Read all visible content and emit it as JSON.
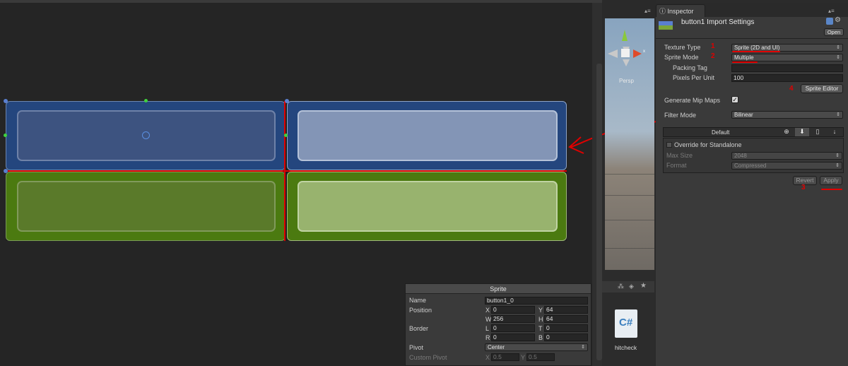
{
  "sprite_panel": {
    "title": "Sprite",
    "name_label": "Name",
    "name_value": "button1_0",
    "position_label": "Position",
    "x_label": "X",
    "x_value": "0",
    "y_label": "Y",
    "y_value": "64",
    "w_label": "W",
    "w_value": "256",
    "h_label": "H",
    "h_value": "64",
    "border_label": "Border",
    "l_label": "L",
    "l_value": "0",
    "t_label": "T",
    "t_value": "0",
    "r_label": "R",
    "r_value": "0",
    "b_label": "B",
    "b_value": "0",
    "pivot_label": "Pivot",
    "pivot_value": "Center",
    "custom_pivot_label": "Custom Pivot",
    "cp_x_label": "X",
    "cp_x_value": "0.5",
    "cp_y_label": "Y",
    "cp_y_value": "0.5"
  },
  "scene": {
    "persp_label": "Persp",
    "gizmo_x": "x"
  },
  "project": {
    "file_name": "hitcheck",
    "file_icon": "C#"
  },
  "inspector": {
    "tab_label": "Inspector",
    "title": "button1 Import Settings",
    "open_label": "Open",
    "texture_type_label": "Texture Type",
    "texture_type_value": "Sprite (2D and UI)",
    "sprite_mode_label": "Sprite Mode",
    "sprite_mode_value": "Multiple",
    "packing_tag_label": "Packing Tag",
    "packing_tag_value": "",
    "ppu_label": "Pixels Per Unit",
    "ppu_value": "100",
    "sprite_editor_label": "Sprite Editor",
    "mip_label": "Generate Mip Maps",
    "filter_label": "Filter Mode",
    "filter_value": "Bilinear",
    "platform_default": "Default",
    "override_label": "Override for Standalone",
    "max_size_label": "Max Size",
    "max_size_value": "2048",
    "format_label": "Format",
    "format_value": "Compressed",
    "revert_label": "Revert",
    "apply_label": "Apply"
  },
  "annotations": [
    "1",
    "2",
    "3",
    "4"
  ],
  "colors": {
    "blue_frame": "#24467e",
    "blue_inner_dark": "#3d5380",
    "blue_inner_light": "#8395b6",
    "green_frame": "#4b7a10",
    "green_inner_dark": "#5a7a2a",
    "green_inner_light": "#98b36e",
    "annotation_red": "#e00000"
  }
}
